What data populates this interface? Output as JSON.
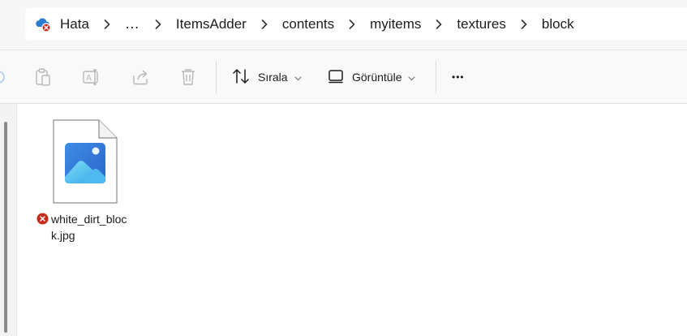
{
  "address_bar": {
    "crumbs": [
      "Hata",
      "…",
      "ItemsAdder",
      "contents",
      "myitems",
      "textures",
      "block"
    ]
  },
  "toolbar": {
    "sort_label": "Sırala",
    "view_label": "Görüntüle",
    "more_label": "•••"
  },
  "files": [
    {
      "name": "white_dirt_block.jpg",
      "status": "error"
    }
  ],
  "colors": {
    "accent": "#1a73e8",
    "error": "#c42b1c",
    "cloud": "#2b7cd3"
  }
}
